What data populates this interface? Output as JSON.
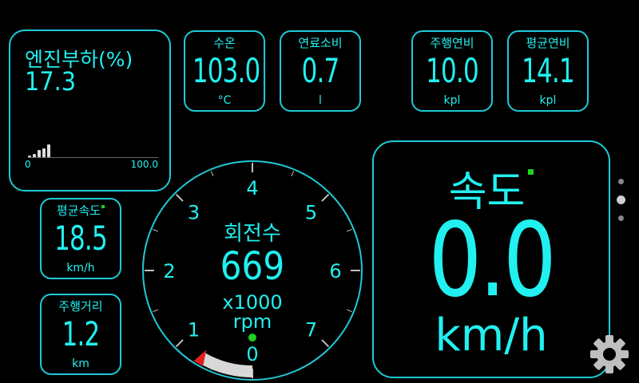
{
  "engine_load": {
    "label": "엔진부하(%)",
    "value": "17.3",
    "axis_min": "0",
    "axis_max": "100.0",
    "bar_levels": [
      0.1,
      0.2,
      0.45,
      0.55,
      0.8
    ]
  },
  "coolant": {
    "label": "수온",
    "value": "103.0",
    "unit": "°C"
  },
  "fuel_consumption": {
    "label": "연료소비",
    "value": "0.7",
    "unit": "l"
  },
  "trip_mileage": {
    "label": "주행연비",
    "value": "10.0",
    "unit": "kpl"
  },
  "avg_mileage": {
    "label": "평균연비",
    "value": "14.1",
    "unit": "kpl"
  },
  "avg_speed": {
    "label": "평균속도",
    "value": "18.5",
    "unit": "km/h"
  },
  "trip_distance": {
    "label": "주행거리",
    "value": "1.2",
    "unit": "km"
  },
  "rpm": {
    "label": "회전수",
    "value": "669",
    "multiplier": "x1000",
    "unit": "rpm",
    "ticks": [
      "0",
      "1",
      "2",
      "3",
      "4",
      "5",
      "6",
      "7"
    ],
    "level": 0.669
  },
  "speed": {
    "label": "속도",
    "value": "0.0",
    "unit": "km/h"
  },
  "pager": {
    "current_page": 2,
    "page_count": 3
  },
  "colors": {
    "accent": "#22f0f0",
    "border": "#1fc9d6",
    "indicator_green": "#1ed21e",
    "needle_red": "#e02020",
    "background": "#000000"
  },
  "icons": {
    "settings": "gear-icon"
  }
}
